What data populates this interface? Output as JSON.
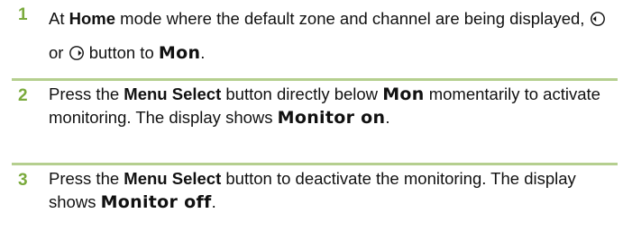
{
  "steps": [
    {
      "number": "1",
      "t1": "At ",
      "b1": "Home",
      "t2": " mode where the default zone and channel are being displayed, ",
      "t3": " or ",
      "t4": " button to ",
      "lcd1": "Mon",
      "t5": "."
    },
    {
      "number": "2",
      "t1": "Press the ",
      "b1": "Menu Select",
      "t2": " button directly below ",
      "lcd1": "Mon",
      "t3": " momentarily to activate monitoring. The display shows ",
      "lcd2": "Monitor on",
      "t4": "."
    },
    {
      "number": "3",
      "t1": "Press the ",
      "b1": "Menu Select",
      "t2": " button to deactivate the monitoring. The display shows ",
      "lcd1": "Monitor off",
      "t3": "."
    }
  ],
  "icons": {
    "left": "left-arrow-button-icon",
    "right": "right-arrow-button-icon"
  },
  "colors": {
    "step_number": "#7aaa3c",
    "rule": "#b5cf8f"
  }
}
